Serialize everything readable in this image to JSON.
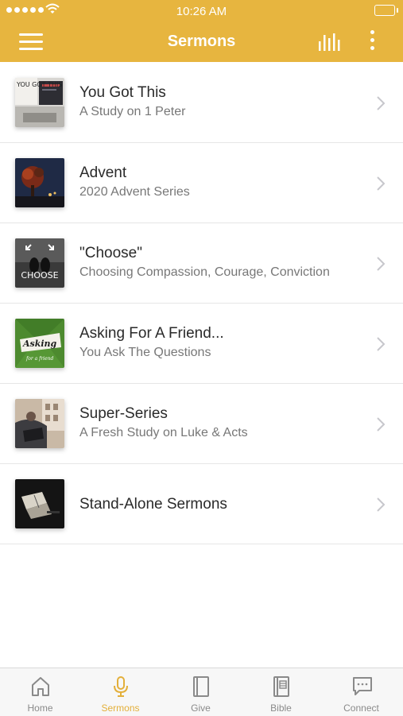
{
  "status": {
    "time": "10:26 AM"
  },
  "header": {
    "title": "Sermons"
  },
  "series": [
    {
      "title": "You Got This",
      "subtitle": "A Study on 1 Peter",
      "thumb_text": "YOU GOT THIS"
    },
    {
      "title": "Advent",
      "subtitle": "2020 Advent Series"
    },
    {
      "title": "\"Choose\"",
      "subtitle": "Choosing Compassion, Courage, Conviction",
      "thumb_text": "CHOOSE"
    },
    {
      "title": "Asking For A Friend...",
      "subtitle": "You Ask The Questions",
      "thumb_text": "Asking",
      "thumb_subtext": "for a friend"
    },
    {
      "title": "Super-Series",
      "subtitle": "A Fresh Study on Luke & Acts"
    },
    {
      "title": "Stand-Alone Sermons"
    }
  ],
  "tabs": [
    {
      "label": "Home",
      "icon": "home-icon"
    },
    {
      "label": "Sermons",
      "icon": "microphone-icon",
      "active": true
    },
    {
      "label": "Give",
      "icon": "book-icon"
    },
    {
      "label": "Bible",
      "icon": "bible-icon"
    },
    {
      "label": "Connect",
      "icon": "chat-icon"
    }
  ],
  "colors": {
    "accent": "#e7b53f",
    "active_tab": "#e3af3a",
    "inactive_tab": "#8a8a8a"
  }
}
